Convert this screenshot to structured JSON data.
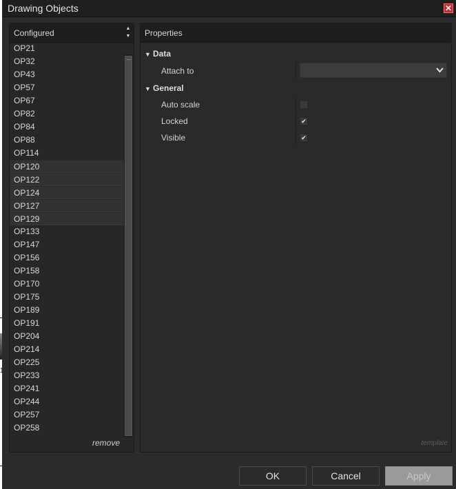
{
  "window": {
    "title": "Drawing Objects"
  },
  "left_panel": {
    "header": "Configured",
    "items": [
      {
        "label": "OP21",
        "selected": false
      },
      {
        "label": "OP32",
        "selected": false
      },
      {
        "label": "OP43",
        "selected": false
      },
      {
        "label": "OP57",
        "selected": false
      },
      {
        "label": "OP67",
        "selected": false
      },
      {
        "label": "OP82",
        "selected": false
      },
      {
        "label": "OP84",
        "selected": false
      },
      {
        "label": "OP88",
        "selected": false
      },
      {
        "label": "OP114",
        "selected": false
      },
      {
        "label": "OP120",
        "selected": true
      },
      {
        "label": "OP122",
        "selected": true
      },
      {
        "label": "OP124",
        "selected": true
      },
      {
        "label": "OP127",
        "selected": true
      },
      {
        "label": "OP129",
        "selected": true
      },
      {
        "label": "OP133",
        "selected": false
      },
      {
        "label": "OP147",
        "selected": false
      },
      {
        "label": "OP156",
        "selected": false
      },
      {
        "label": "OP158",
        "selected": false
      },
      {
        "label": "OP170",
        "selected": false
      },
      {
        "label": "OP175",
        "selected": false
      },
      {
        "label": "OP189",
        "selected": false
      },
      {
        "label": "OP191",
        "selected": false
      },
      {
        "label": "OP204",
        "selected": false
      },
      {
        "label": "OP214",
        "selected": false
      },
      {
        "label": "OP225",
        "selected": false
      },
      {
        "label": "OP233",
        "selected": false
      },
      {
        "label": "OP241",
        "selected": false
      },
      {
        "label": "OP244",
        "selected": false
      },
      {
        "label": "OP257",
        "selected": false
      },
      {
        "label": "OP258",
        "selected": false
      }
    ],
    "remove_label": "remove"
  },
  "properties": {
    "header": "Properties",
    "data_category": "Data",
    "attach_to_label": "Attach to",
    "attach_to_value": "",
    "general_category": "General",
    "auto_scale_label": "Auto scale",
    "auto_scale_checked": false,
    "locked_label": "Locked",
    "locked_checked": true,
    "visible_label": "Visible",
    "visible_checked": true,
    "template_label": "template"
  },
  "buttons": {
    "ok": "OK",
    "cancel": "Cancel",
    "apply": "Apply"
  },
  "bg_fragment": "1",
  "icons": {
    "close": "close-icon",
    "sort": "sort-arrows-icon",
    "expand": "triangle-down-icon",
    "dropdown": "chevron-down-icon",
    "check": "checkmark-icon"
  }
}
